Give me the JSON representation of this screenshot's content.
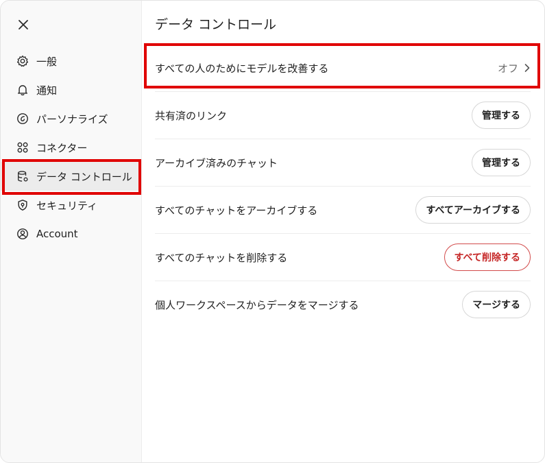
{
  "sidebar": {
    "items": [
      {
        "label": "一般",
        "icon": "gear-icon"
      },
      {
        "label": "通知",
        "icon": "bell-icon"
      },
      {
        "label": "パーソナライズ",
        "icon": "personalize-icon"
      },
      {
        "label": "コネクター",
        "icon": "connector-icon"
      },
      {
        "label": "データ コントロール",
        "icon": "database-icon"
      },
      {
        "label": "セキュリティ",
        "icon": "shield-icon"
      },
      {
        "label": "Account",
        "icon": "account-icon"
      }
    ],
    "active_index": 4
  },
  "main": {
    "title": "データ コントロール",
    "rows": [
      {
        "label": "すべての人のためにモデルを改善する",
        "value": "オフ"
      },
      {
        "label": "共有済のリンク",
        "button": "管理する"
      },
      {
        "label": "アーカイブ済みのチャット",
        "button": "管理する"
      },
      {
        "label": "すべてのチャットをアーカイブする",
        "button": "すべてアーカイブする"
      },
      {
        "label": "すべてのチャットを削除する",
        "button": "すべて削除する"
      },
      {
        "label": "個人ワークスペースからデータをマージする",
        "button": "マージする"
      }
    ]
  },
  "colors": {
    "highlight": "#e00000",
    "danger": "#c62828",
    "active_bg": "#ececec"
  }
}
